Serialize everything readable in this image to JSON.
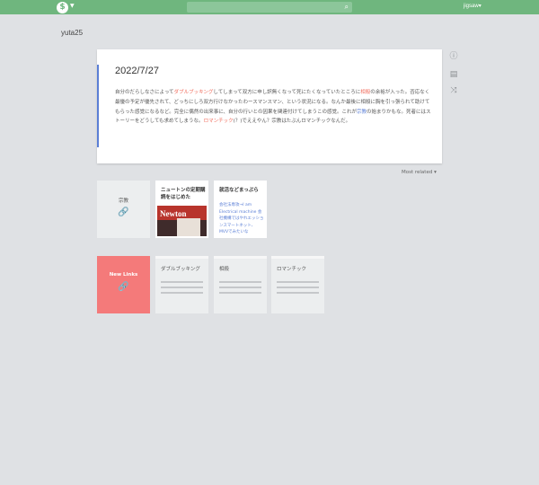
{
  "topbar": {
    "logo_glyph": "$",
    "user_label": "jigsaw"
  },
  "owner": "yuta25",
  "page": {
    "title": "2022/7/27",
    "body": [
      {
        "t": "自分のだらしなさによって",
        "c": ""
      },
      {
        "t": "ダブルブッキング",
        "c": "lnk"
      },
      {
        "t": "してしまって双方に申し訳無くなって死にたくなっていたところに",
        "c": ""
      },
      {
        "t": "相殺",
        "c": "lnk"
      },
      {
        "t": "の余裕が入った。否応なく最優の予定が優先されて、どっちにしろ双方行けなかったわースマンスマン、という状況になる。なんか最後に相殺に胸を引っ張られて助けてもらった感覚になるなど。完全に偶然の出来事に、自分の行いとの因果を関連付けてしまうこの感覚。これが",
        "c": ""
      },
      {
        "t": "宗教",
        "c": "lnk2"
      },
      {
        "t": "の始まりかもな。死者にはストーリーをどうしても求めてしまうな。",
        "c": ""
      },
      {
        "t": "ロマンチック",
        "c": "lnk"
      },
      {
        "t": "(？)でええやん？宗教はたぶんロマンチックなんだ。",
        "c": ""
      }
    ]
  },
  "side_icons": [
    "info-icon",
    "document-icon",
    "shuffle-icon"
  ],
  "sort_label": "Most related",
  "related": [
    {
      "type": "link",
      "label": "宗教"
    },
    {
      "type": "image",
      "title": "ニュートンの定期購読をはじめた",
      "image_text": "Newton"
    },
    {
      "type": "text",
      "title": "就活などまっぷら",
      "excerpt": "会社法専攻→I am Electrical machine 会社機構ではやれエッションスマートネット、MVVでみたいな"
    }
  ],
  "new_links": {
    "label": "New Links",
    "pages": [
      "ダブルブッキング",
      "相殺",
      "ロマンチック"
    ]
  },
  "colors": {
    "header": "#6fb67e",
    "accent": "#5b7fd6",
    "link": "#f06b5b",
    "new_links_bg": "#f47a7a"
  }
}
